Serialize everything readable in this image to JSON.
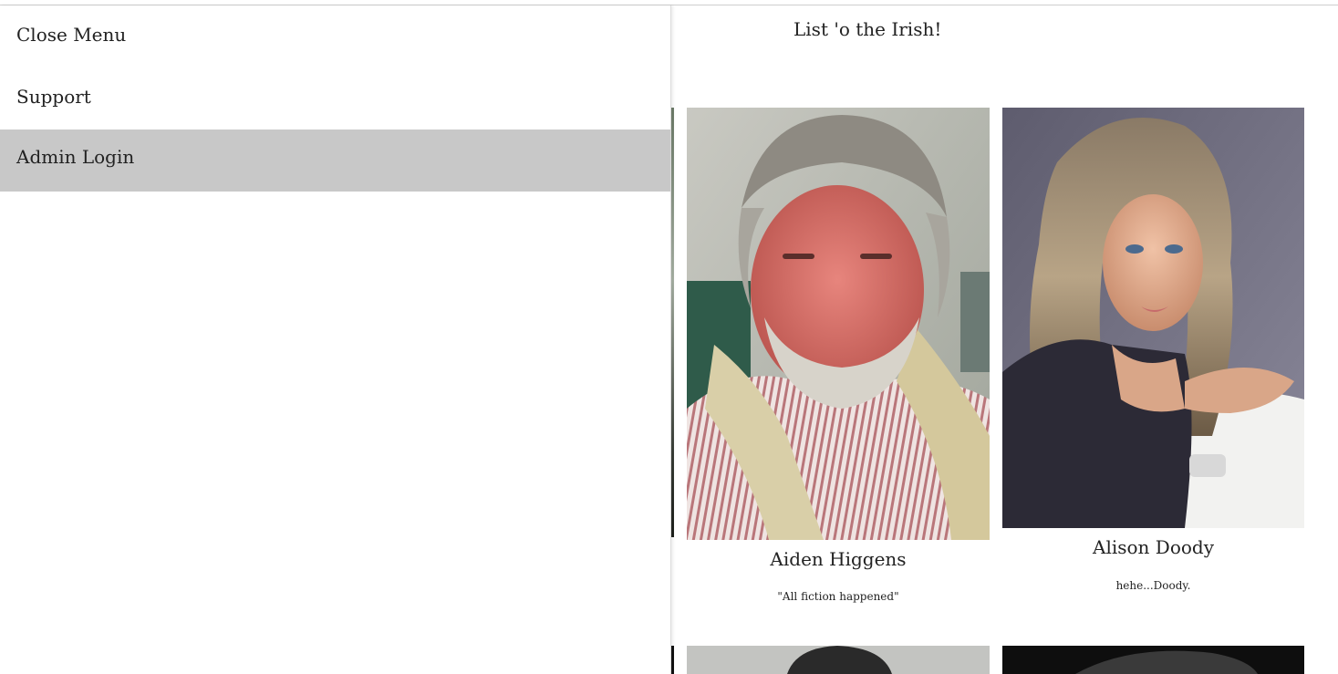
{
  "menu": {
    "items": [
      {
        "label": "Close Menu"
      },
      {
        "label": "Support"
      },
      {
        "label": "Admin Login"
      }
    ]
  },
  "page": {
    "title": "List 'o the Irish!"
  },
  "cards": [
    {
      "name": "Aiden Higgens",
      "quote": "\"All fiction happened\""
    },
    {
      "name": "Alison Doody",
      "quote": "hehe...Doody."
    }
  ],
  "colors": {
    "menu_highlight": "#c8c8c8",
    "text": "#222222"
  }
}
